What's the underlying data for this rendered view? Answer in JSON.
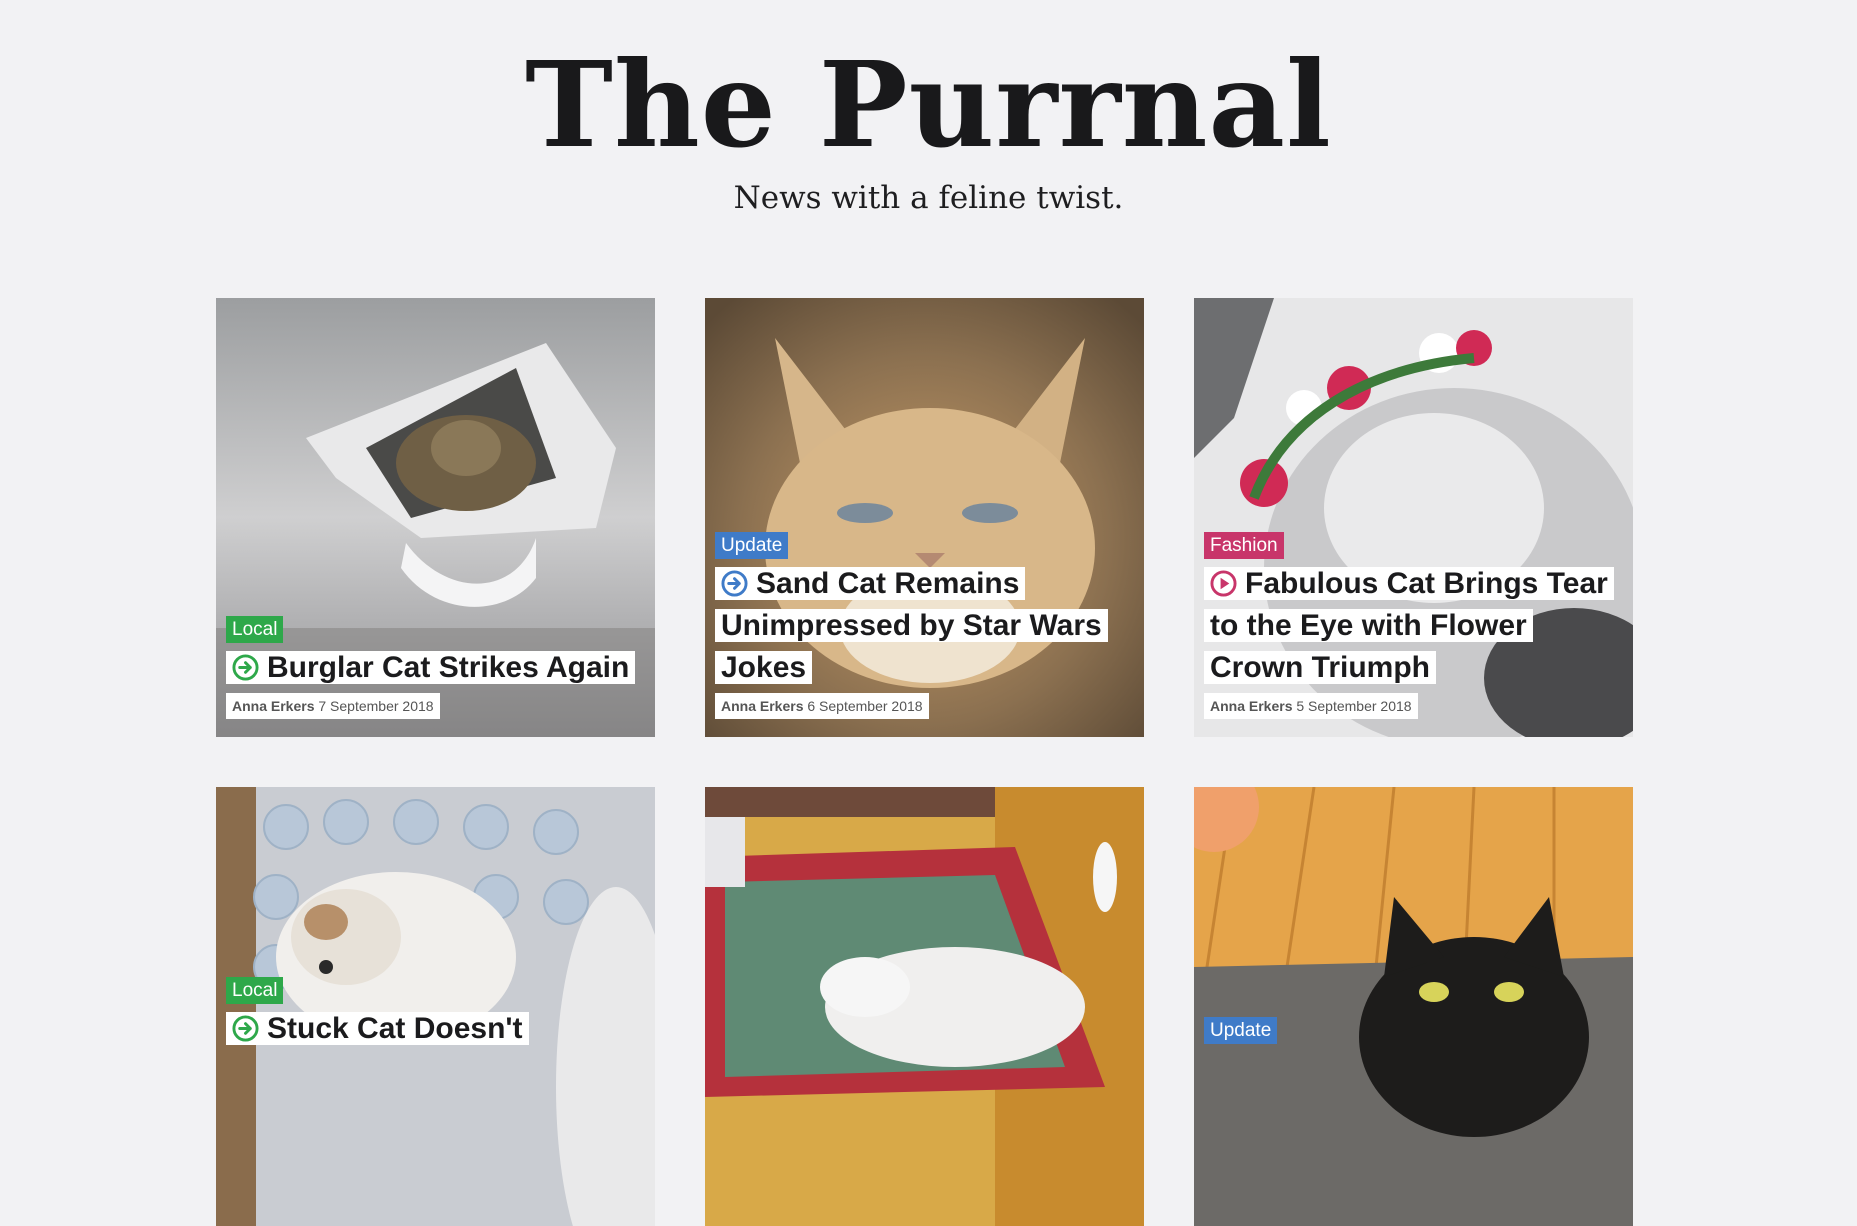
{
  "masthead": {
    "title": "The Purrnal",
    "tagline": "News with a feline twist."
  },
  "colors": {
    "background": "#f2f2f4",
    "local": "#2ea84a",
    "update": "#3f7bc8",
    "fashion": "#c8356a"
  },
  "articles": [
    {
      "category": "Local",
      "icon": "arrow-right-circle-icon",
      "headline": "Burglar Cat Strikes Again",
      "author": "Anna Erkers",
      "date": "7 September 2018"
    },
    {
      "category": "Update",
      "icon": "arrow-right-circle-icon",
      "headline": "Sand Cat Remains Unimpressed by Star Wars Jokes",
      "author": "Anna Erkers",
      "date": "6 September 2018"
    },
    {
      "category": "Fashion",
      "icon": "play-circle-icon",
      "headline": "Fabulous Cat Brings Tear to the Eye with Flower Crown Triumph",
      "author": "Anna Erkers",
      "date": "5 September 2018"
    },
    {
      "category": "Local",
      "icon": "arrow-right-circle-icon",
      "headline": "Stuck Cat Doesn't",
      "author": "",
      "date": ""
    },
    {
      "category": "",
      "icon": "",
      "headline": "",
      "author": "",
      "date": ""
    },
    {
      "category": "Update",
      "icon": "",
      "headline": "",
      "author": "",
      "date": ""
    }
  ]
}
